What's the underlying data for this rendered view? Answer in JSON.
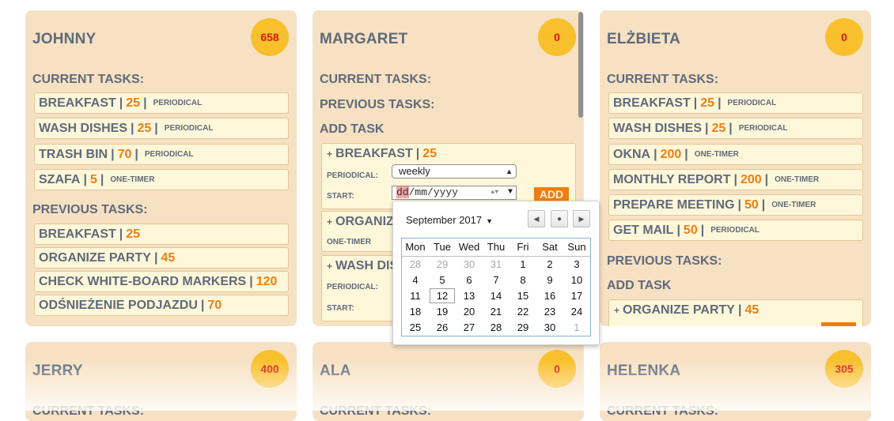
{
  "labels": {
    "current_tasks": "CURRENT TASKS:",
    "previous_tasks": "PREVIOUS TASKS:",
    "add_task": "ADD TASK",
    "periodical_label": "PERIODICAL:",
    "start_label": "START:",
    "one_timer_label": "ONE-TIMER",
    "add_button": "ADD",
    "sep": "|"
  },
  "cards": {
    "johnny": {
      "name": "JOHNNY",
      "points": "658",
      "current": [
        {
          "name": "BREAKFAST",
          "points": "25",
          "type": "PERIODICAL"
        },
        {
          "name": "WASH DISHES",
          "points": "25",
          "type": "PERIODICAL"
        },
        {
          "name": "TRASH BIN",
          "points": "70",
          "type": "PERIODICAL"
        },
        {
          "name": "SZAFA",
          "points": "5",
          "type": "ONE-TIMER"
        }
      ],
      "previous": [
        {
          "name": "BREAKFAST",
          "points": "25"
        },
        {
          "name": "ORGANIZE PARTY",
          "points": "45"
        },
        {
          "name": "CHECK WHITE-BOARD MARKERS",
          "points": "120"
        },
        {
          "name": "ODŚNIEŻENIE PODJAZDU",
          "points": "70"
        }
      ]
    },
    "margaret": {
      "name": "MARGARET",
      "points": "0",
      "add": [
        {
          "name": "BREAKFAST",
          "points": "25",
          "periodical_value": "weekly",
          "date_dd": "dd",
          "date_rest": "/mm/yyyy"
        },
        {
          "name": "ORGANIZ"
        },
        {
          "name": "WASH DIS"
        }
      ]
    },
    "elzbieta": {
      "name": "ELŻBIETA",
      "points": "0",
      "current": [
        {
          "name": "BREAKFAST",
          "points": "25",
          "type": "PERIODICAL"
        },
        {
          "name": "WASH DISHES",
          "points": "25",
          "type": "PERIODICAL"
        },
        {
          "name": "OKNA",
          "points": "200",
          "type": "ONE-TIMER"
        },
        {
          "name": "MONTHLY REPORT",
          "points": "200",
          "type": "ONE-TIMER"
        },
        {
          "name": "PREPARE MEETING",
          "points": "50",
          "type": "ONE-TIMER"
        },
        {
          "name": "GET MAIL",
          "points": "50",
          "type": "PERIODICAL"
        }
      ],
      "add": [
        {
          "name": "ORGANIZE PARTY",
          "points": "45"
        }
      ]
    },
    "jerry": {
      "name": "JERRY",
      "points": "400"
    },
    "ala": {
      "name": "ALA",
      "points": "0"
    },
    "helenka": {
      "name": "HELENKA",
      "points": "305"
    }
  },
  "calendar": {
    "month_label": "September 2017",
    "weekdays": [
      "Mon",
      "Tue",
      "Wed",
      "Thu",
      "Fri",
      "Sat",
      "Sun"
    ],
    "weeks": [
      [
        {
          "d": "28",
          "dim": true
        },
        {
          "d": "29",
          "dim": true
        },
        {
          "d": "30",
          "dim": true
        },
        {
          "d": "31",
          "dim": true
        },
        {
          "d": "1"
        },
        {
          "d": "2"
        },
        {
          "d": "3"
        }
      ],
      [
        {
          "d": "4"
        },
        {
          "d": "5"
        },
        {
          "d": "6"
        },
        {
          "d": "7"
        },
        {
          "d": "8"
        },
        {
          "d": "9"
        },
        {
          "d": "10"
        }
      ],
      [
        {
          "d": "11"
        },
        {
          "d": "12",
          "today": true
        },
        {
          "d": "13"
        },
        {
          "d": "14"
        },
        {
          "d": "15"
        },
        {
          "d": "16"
        },
        {
          "d": "17"
        }
      ],
      [
        {
          "d": "18"
        },
        {
          "d": "19"
        },
        {
          "d": "20"
        },
        {
          "d": "21"
        },
        {
          "d": "22"
        },
        {
          "d": "23"
        },
        {
          "d": "24"
        }
      ],
      [
        {
          "d": "25"
        },
        {
          "d": "26"
        },
        {
          "d": "27"
        },
        {
          "d": "28"
        },
        {
          "d": "29"
        },
        {
          "d": "30"
        },
        {
          "d": "1",
          "dim": true
        }
      ]
    ]
  },
  "colors": {
    "card_bg": "#f7e1c3",
    "badge_bg": "#f9c02d",
    "badge_text": "#e4150f",
    "points_text": "#ef7d12",
    "label_text": "#5f6a7a",
    "task_bg": "#fff7d9"
  }
}
